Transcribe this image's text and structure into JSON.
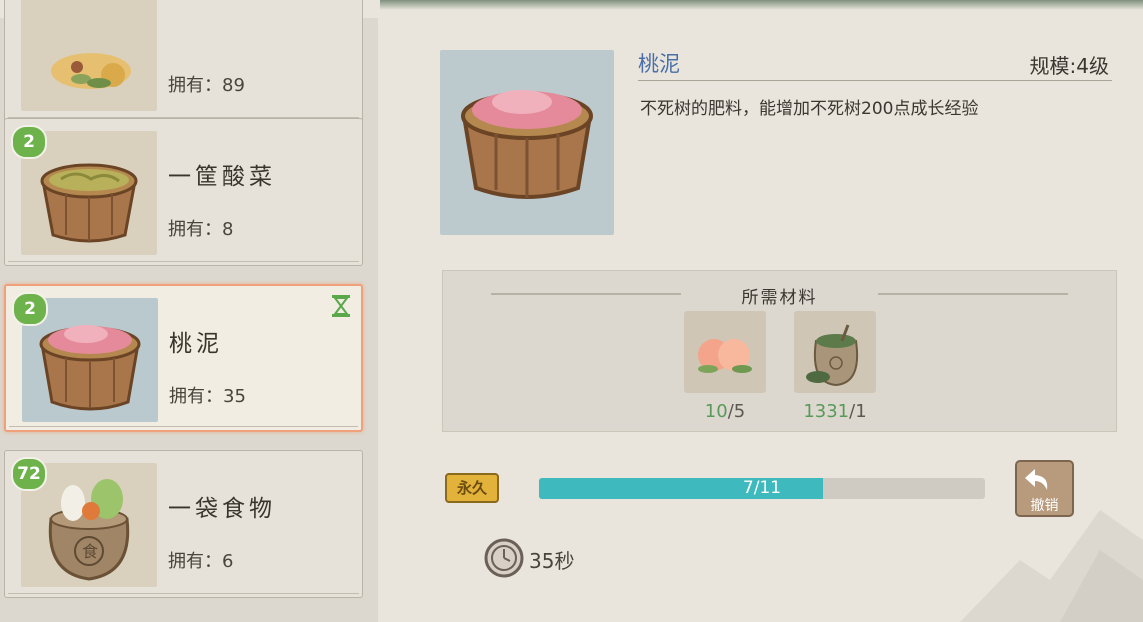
{
  "item_list": [
    {
      "badge": "",
      "name": "",
      "owned": "拥有：89",
      "selected": false
    },
    {
      "badge": "2",
      "name": "一筐酸菜",
      "owned": "拥有：8",
      "selected": false
    },
    {
      "badge": "2",
      "name": "桃泥",
      "owned": "拥有：35",
      "selected": true
    },
    {
      "badge": "72",
      "name": "一袋食物",
      "owned": "拥有：6",
      "selected": false
    }
  ],
  "detail": {
    "name": "桃泥",
    "level": "规模:4级",
    "description": "不死树的肥料，能增加不死树200点成长经验"
  },
  "materials": {
    "title": "所需材料",
    "items": [
      {
        "icon": "peach-icon",
        "have": "10",
        "need": "/5"
      },
      {
        "icon": "fertilizer-sack-icon",
        "have": "1331",
        "need": "/1"
      }
    ]
  },
  "production": {
    "permanent_label": "永久",
    "progress_text": "7/11",
    "progress_fraction": 0.6364,
    "undo_label": "撤销",
    "time_label": "35秒"
  },
  "colors": {
    "accent_teal": "#3eb9bd",
    "badge_green": "#6db24a",
    "name_blue": "#4a6fa8",
    "selected_border": "#f0a07a"
  }
}
